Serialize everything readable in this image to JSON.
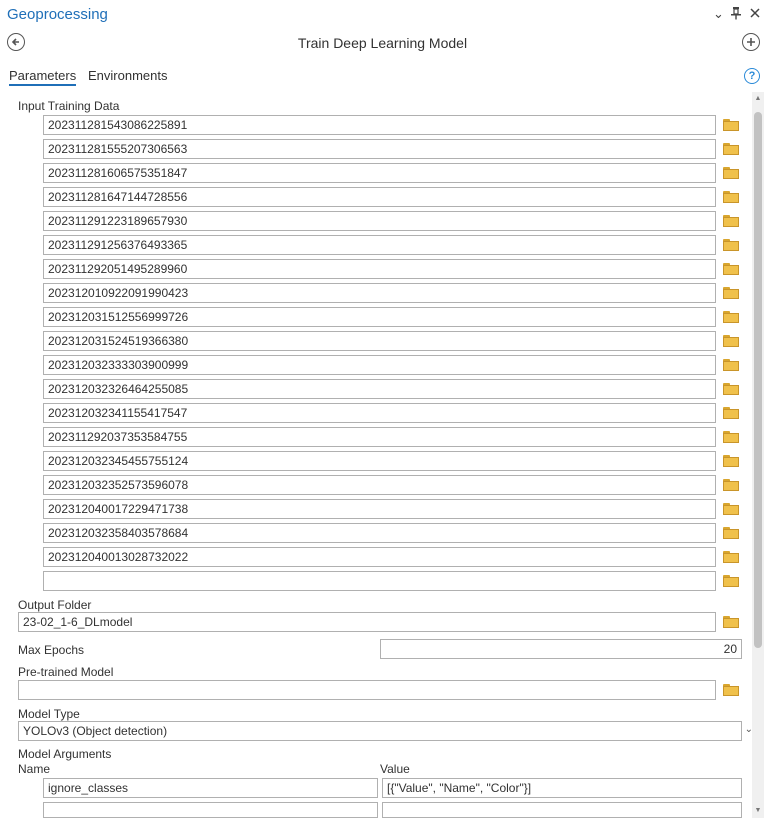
{
  "pane": {
    "title": "Geoprocessing"
  },
  "tool": {
    "title": "Train Deep Learning Model"
  },
  "tabs": {
    "parameters": "Parameters",
    "environments": "Environments"
  },
  "help_icon": "?",
  "params": {
    "input_training_data": {
      "label": "Input Training Data",
      "items": [
        "20231128154308622589​1",
        "20231128155520730656​3",
        "20231128160657535184​7",
        "20231128164714472855​6",
        "20231129122318965793​0",
        "20231129125637649336​5",
        "20231129205149528996​0",
        "20231201092209199042​3",
        "20231203151255699972​6",
        "20231203152451936638​0",
        "20231203233330390099​9",
        "20231203232646425508​5",
        "20231203234115541754​7",
        "20231129203735358475​5",
        "20231203234545575512​4",
        "20231203235257359607​8",
        "20231204001722947173​8",
        "20231203235840357868​4",
        "20231204001302873202​2",
        ""
      ]
    },
    "output_folder": {
      "label": "Output Folder",
      "value": "23-02_1-6_DLmodel"
    },
    "max_epochs": {
      "label": "Max Epochs",
      "value": "20"
    },
    "pretrained_model": {
      "label": "Pre-trained Model",
      "value": ""
    },
    "model_type": {
      "label": "Model Type",
      "value": "YOLOv3 (Object detection)"
    },
    "model_arguments": {
      "label": "Model Arguments",
      "col_name": "Name",
      "col_value": "Value",
      "rows": [
        {
          "name": "ignore_classes",
          "value": "[{\"Value\", \"Name\", \"Color\"}]"
        },
        {
          "name": "",
          "value": ""
        }
      ]
    }
  },
  "icons": [
    "back-icon",
    "add-icon",
    "chevron-down-icon",
    "pin-icon",
    "close-icon",
    "help-icon",
    "folder-icon"
  ],
  "colors": {
    "accent": "#1f6fb8",
    "folder": "#f0c14b"
  }
}
